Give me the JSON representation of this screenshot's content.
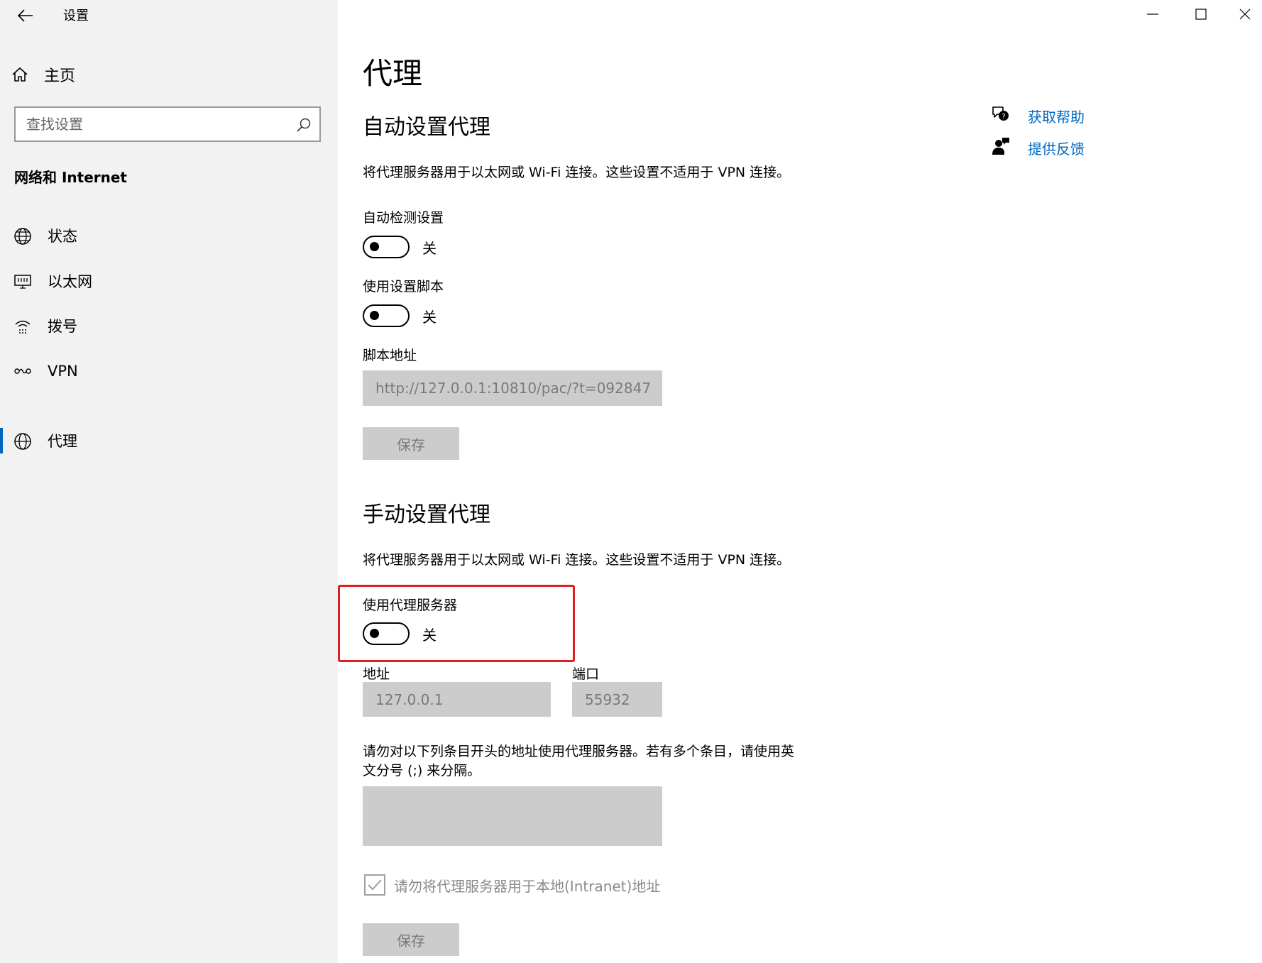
{
  "window": {
    "app_title": "设置",
    "controls": {
      "minimize": "minimize",
      "maximize": "maximize",
      "close": "close"
    }
  },
  "sidebar": {
    "home_label": "主页",
    "search_placeholder": "查找设置",
    "section_title": "网络和 Internet",
    "items": [
      {
        "label": "状态",
        "icon": "status-globe-icon"
      },
      {
        "label": "以太网",
        "icon": "ethernet-icon"
      },
      {
        "label": "拨号",
        "icon": "dialup-icon"
      },
      {
        "label": "VPN",
        "icon": "vpn-icon"
      },
      {
        "label": "代理",
        "icon": "proxy-globe-icon",
        "selected": true
      }
    ],
    "accent_color": "#0067c0"
  },
  "main": {
    "page_title": "代理",
    "auto": {
      "heading": "自动设置代理",
      "description": "将代理服务器用于以太网或 Wi-Fi 连接。这些设置不适用于 VPN 连接。",
      "detect_label": "自动检测设置",
      "detect_state": "关",
      "script_label": "使用设置脚本",
      "script_state": "关",
      "address_label": "脚本地址",
      "address_value": "http://127.0.0.1:10810/pac/?t=092847",
      "save_label": "保存"
    },
    "manual": {
      "heading": "手动设置代理",
      "description": "将代理服务器用于以太网或 Wi-Fi 连接。这些设置不适用于 VPN 连接。",
      "use_proxy_label": "使用代理服务器",
      "use_proxy_state": "关",
      "address_label": "地址",
      "address_value": "127.0.0.1",
      "port_label": "端口",
      "port_value": "55932",
      "exceptions_line1": "请勿对以下列条目开头的地址使用代理服务器。若有多个条目，请使用英",
      "exceptions_line2": "文分号 (;) 来分隔。",
      "exceptions_value": "",
      "local_checkbox_label": "请勿将代理服务器用于本地(Intranet)地址",
      "local_checkbox_checked": true,
      "save_label": "保存"
    }
  },
  "help": {
    "get_help": "获取帮助",
    "feedback": "提供反馈",
    "link_color": "#0067c0"
  },
  "annotation": {
    "highlight_color": "#e02020"
  }
}
